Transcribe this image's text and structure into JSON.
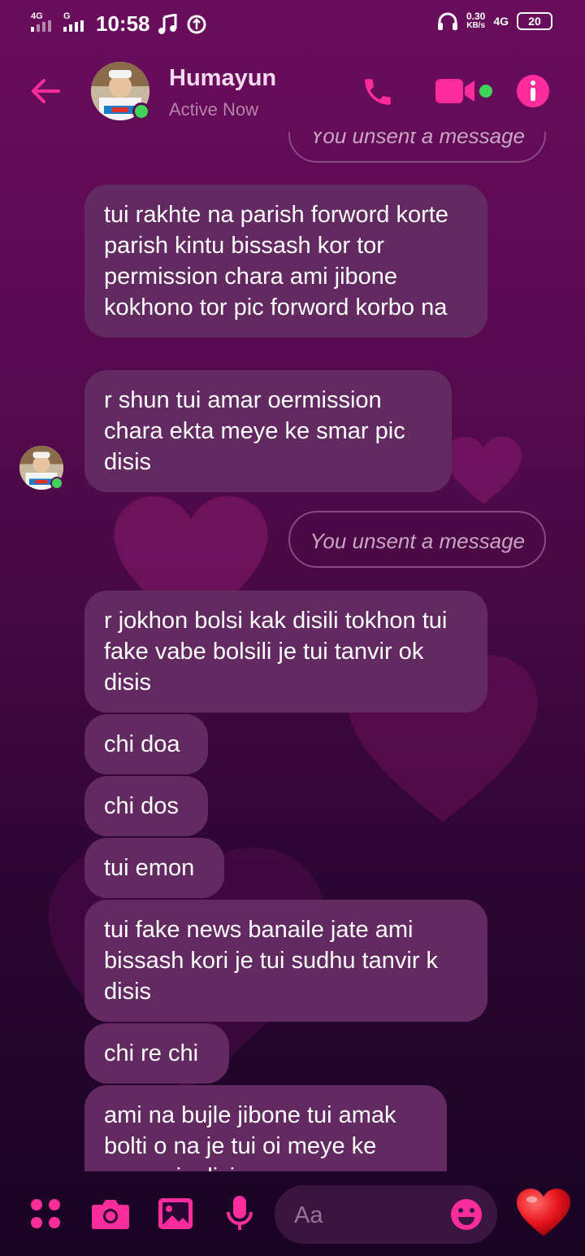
{
  "status_bar": {
    "net1_top": "4G",
    "net2_top": "G",
    "time": "10:58",
    "speed_value": "0.30",
    "speed_unit": "KB/s",
    "net3": "4G",
    "battery": "20"
  },
  "header": {
    "contact_name": "Humayun",
    "contact_status": "Active Now",
    "accent_color": "#ff2d9b",
    "online_color": "#3fd35a"
  },
  "messages": [
    {
      "type": "unsent",
      "text": "You unsent a message"
    },
    {
      "type": "received",
      "text": "tui rakhte na parish forword korte parish kintu bissash kor tor permission chara ami jibone kokhono tor pic forword korbo na"
    },
    {
      "type": "received",
      "text": "r shun tui amar oermission chara ekta meye ke smar pic disis"
    },
    {
      "type": "unsent",
      "text": "You unsent a message"
    },
    {
      "type": "received",
      "text": "r jokhon bolsi kak disili tokhon tui fake vabe bolsili je tui tanvir ok disis"
    },
    {
      "type": "received",
      "text": "chi doa"
    },
    {
      "type": "received",
      "text": "chi dos"
    },
    {
      "type": "received",
      "text": "tui emon"
    },
    {
      "type": "received",
      "text": "tui fake news banaile jate ami bissash kori je tui sudhu tanvir k disis"
    },
    {
      "type": "received",
      "text": "chi re chi"
    },
    {
      "type": "received",
      "text": "ami na bujle jibone tui amak bolti o na je tui oi meye ke smar pic disis"
    }
  ],
  "composer": {
    "placeholder": "Aa",
    "icons": [
      "menu-dots-icon",
      "camera-icon",
      "gallery-icon",
      "mic-icon",
      "emoji-icon",
      "heart-like-icon"
    ]
  }
}
